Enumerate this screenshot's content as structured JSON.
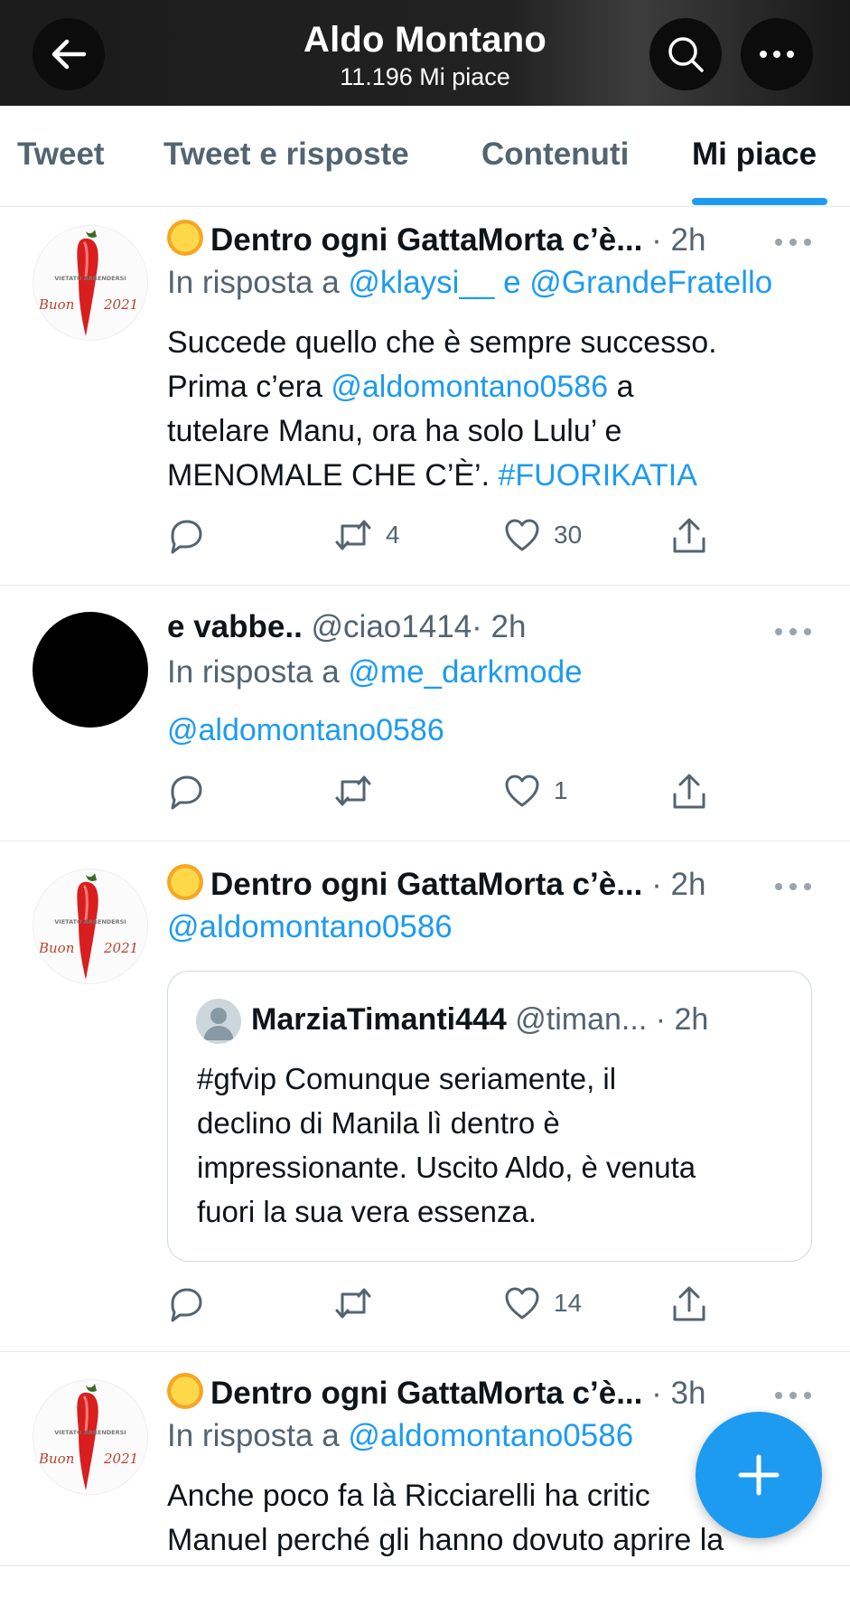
{
  "header": {
    "title": "Aldo Montano",
    "subtitle": "11.196 Mi piace",
    "back_icon": "arrow-left-icon",
    "search_icon": "search-icon",
    "more_icon": "more-icon"
  },
  "tabs": [
    {
      "label": "Tweet"
    },
    {
      "label": "Tweet e risposte"
    },
    {
      "label": "Contenuti"
    },
    {
      "label": "Mi piace",
      "active": true
    }
  ],
  "colors": {
    "accent": "#1d9bf0",
    "text": "#0f1419",
    "muted": "#536471"
  },
  "avatar_image_text": {
    "top": "VIETATO ARRENDERSI",
    "bottom_left": "Buon",
    "bottom_right": "2021"
  },
  "tweets": [
    {
      "name": "Dentro ogni GattaMorta c’è...",
      "time": "· 2h",
      "reply_prefix": "In risposta a",
      "reply_users": "@klaysi__ e @GrandeFratello",
      "body": [
        "Succede quello che è sempre successo.",
        "Prima c’era ",
        "@aldomontano0586",
        " a",
        "tutelare Manu, ora ha solo Lulu’ e",
        "MENOMALE CHE C’È’. ",
        "#FUORIKATIA"
      ],
      "retweets": "4",
      "likes": "30"
    },
    {
      "name": "e vabbe..",
      "handle": "@ciao1414",
      "time": "· 2h",
      "reply_prefix": "In risposta a",
      "reply_users": "@me_darkmode",
      "mention": "@aldomontano0586",
      "retweets": "",
      "likes": "1"
    },
    {
      "name": "Dentro ogni GattaMorta c’è...",
      "time": "· 2h",
      "mention": "@aldomontano0586",
      "quote": {
        "name": "MarziaTimanti444",
        "handle": "@timan...",
        "time": "· 2h",
        "lines": [
          "#gfvip Comunque seriamente, il",
          "declino di Manila lì dentro è",
          "impressionante. Uscito Aldo, è venuta",
          "fuori la sua vera essenza."
        ]
      },
      "retweets": "",
      "likes": "14"
    },
    {
      "name": "Dentro ogni GattaMorta c’è...",
      "time": "· 3h",
      "reply_prefix": "In risposta a",
      "reply_users": "@aldomontano0586",
      "lines": [
        "Anche poco fa là Ricciarelli ha critic",
        "Manuel perché gli hanno dovuto aprire la"
      ]
    }
  ],
  "fab": {
    "icon": "plus-icon"
  }
}
